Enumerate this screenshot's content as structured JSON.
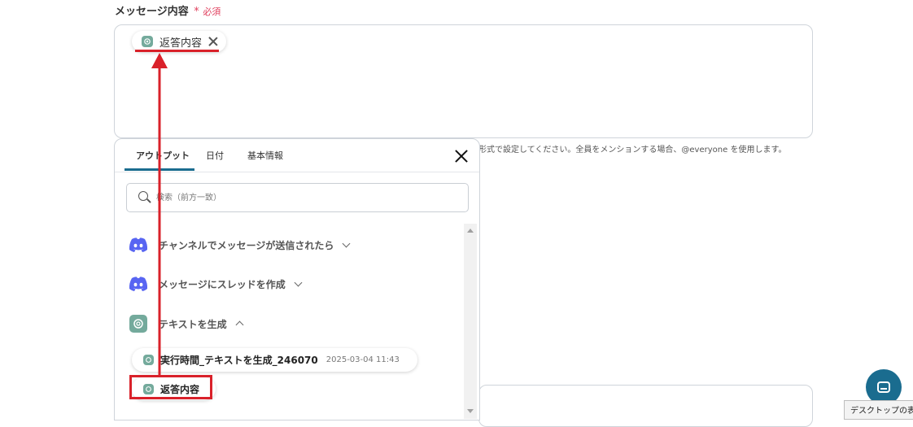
{
  "field": {
    "label": "メッセージ内容",
    "required_mark": "*",
    "required_text": "必須"
  },
  "message_chip": {
    "label": "返答内容",
    "icon": "chatgpt-icon"
  },
  "hint": "形式で設定してください。全員をメンションする場合、@everyone を使用します。",
  "panel": {
    "tabs": [
      {
        "label": "アウトプット",
        "active": true
      },
      {
        "label": "日付",
        "active": false
      },
      {
        "label": "基本情報",
        "active": false
      }
    ],
    "search_placeholder": "検索（前方一致）",
    "groups": [
      {
        "label": "チャンネルでメッセージが送信されたら",
        "icon": "discord-icon",
        "expanded": false
      },
      {
        "label": "メッセージにスレッドを作成",
        "icon": "discord-icon",
        "expanded": false
      },
      {
        "label": "テキストを生成",
        "icon": "chatgpt-icon",
        "expanded": true
      }
    ],
    "items": [
      {
        "label": "実行時間_テキストを生成_246070",
        "value": "2025-03-04 11:43"
      },
      {
        "label": "返答内容"
      }
    ]
  },
  "desktop_tooltip": "デスクトップの表示",
  "colors": {
    "accent": "#1a6c8f",
    "required": "#e0405e",
    "annotation": "#d9212a",
    "discord": "#5865f2",
    "chatgpt": "#74aa9c"
  }
}
